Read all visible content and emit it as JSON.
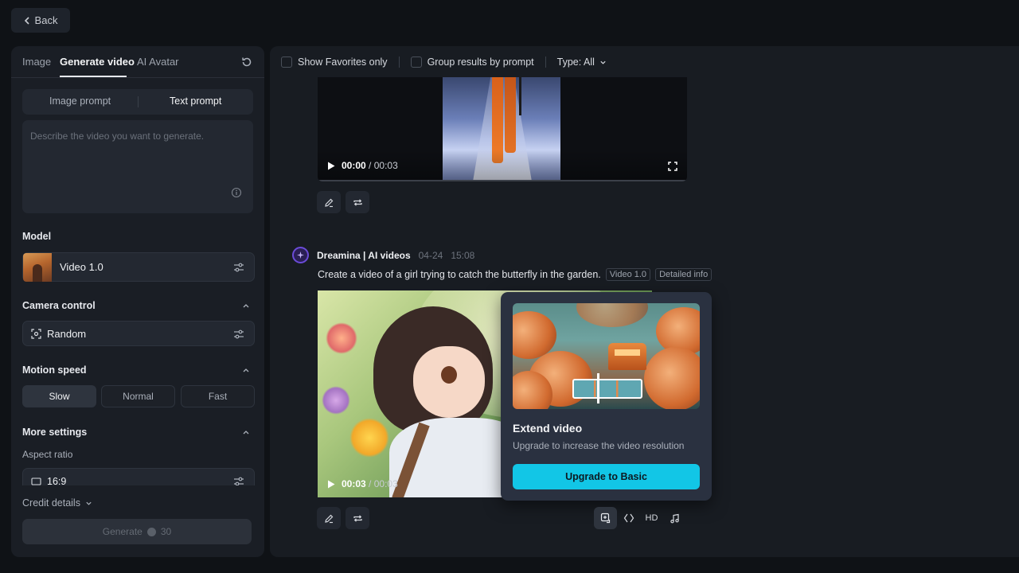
{
  "back": {
    "label": "Back"
  },
  "left": {
    "tabs": [
      {
        "label": "Image"
      },
      {
        "label": "Generate video"
      },
      {
        "label": "AI Avatar"
      }
    ],
    "prompt_mode": {
      "image": "Image prompt",
      "text": "Text prompt"
    },
    "prompt_placeholder": "Describe the video you want to generate.",
    "model": {
      "title": "Model",
      "value": "Video 1.0"
    },
    "camera": {
      "title": "Camera control",
      "value": "Random"
    },
    "motion": {
      "title": "Motion speed",
      "options": [
        "Slow",
        "Normal",
        "Fast"
      ],
      "selected": "Slow"
    },
    "more": {
      "title": "More settings",
      "aspect_label": "Aspect ratio",
      "aspect_value": "16:9"
    },
    "credit_details": "Credit details",
    "generate": {
      "label": "Generate",
      "cost": "30"
    }
  },
  "filters": {
    "favorites": "Show Favorites only",
    "group": "Group results by prompt",
    "type": "Type: All"
  },
  "video1": {
    "time_current": "00:00",
    "time_total": "/ 00:03"
  },
  "post": {
    "author": "Dreamina | AI videos",
    "date": "04-24",
    "time": "15:08",
    "prompt": "Create a video of a girl trying to catch the butterfly in the garden.",
    "chip_model": "Video 1.0",
    "chip_info": "Detailed info"
  },
  "video2": {
    "time_current": "00:03",
    "time_total": "/ 00:03"
  },
  "popup": {
    "title": "Extend video",
    "desc": "Upgrade to increase the video resolution",
    "button": "Upgrade to Basic"
  },
  "tools": {
    "hd": "HD"
  }
}
